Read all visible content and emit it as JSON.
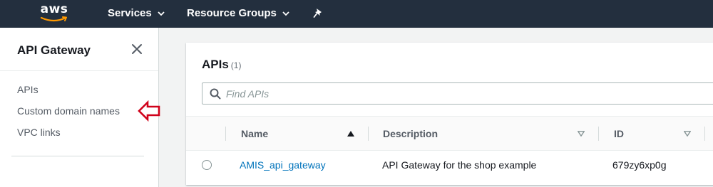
{
  "topnav": {
    "logo_text": "aws",
    "services_label": "Services",
    "resource_groups_label": "Resource Groups"
  },
  "sidebar": {
    "title": "API Gateway",
    "items": [
      {
        "label": "APIs"
      },
      {
        "label": "Custom domain names"
      },
      {
        "label": "VPC links"
      }
    ],
    "annotation_arrow_color": "#d0021b"
  },
  "main": {
    "title": "APIs",
    "count": "(1)",
    "search": {
      "placeholder": "Find APIs",
      "value": ""
    },
    "table": {
      "columns": [
        {
          "label": "Name",
          "sort": "ascending"
        },
        {
          "label": "Description",
          "sort": "none"
        },
        {
          "label": "ID",
          "sort": "none"
        }
      ],
      "rows": [
        {
          "name": "AMIS_api_gateway",
          "description": "API Gateway for the shop example",
          "id": "679zy6xp0g"
        }
      ]
    }
  },
  "colors": {
    "nav_bg": "#232f3e",
    "link": "#0073bb",
    "page_bg": "#f2f3f3",
    "aws_smile": "#ff9900"
  }
}
